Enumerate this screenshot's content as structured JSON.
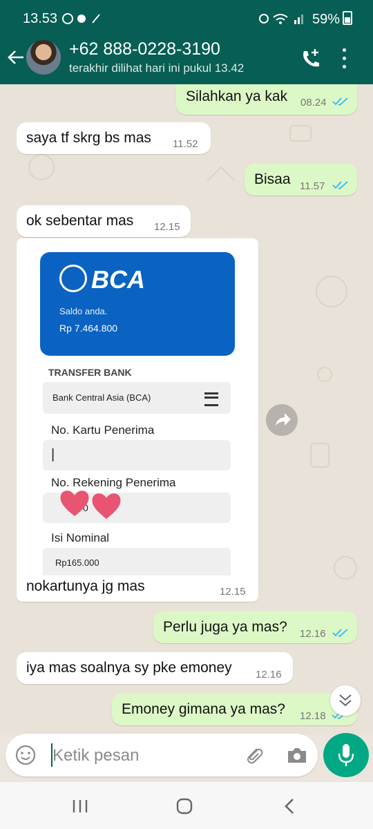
{
  "status_bar": {
    "time": "13.53",
    "battery": "59%"
  },
  "header": {
    "contact_name": "+62 888-0228-3190",
    "last_seen": "terakhir dilihat hari ini pukul 13.42"
  },
  "messages": [
    {
      "direction": "out",
      "text": "Silahkan ya kak",
      "time": "08.24",
      "read": true
    },
    {
      "direction": "in",
      "text": "saya tf skrg bs mas",
      "time": "11.52"
    },
    {
      "direction": "out",
      "text": "Bisaa",
      "time": "11.57",
      "read": true
    },
    {
      "direction": "in",
      "text": "ok sebentar mas",
      "time": "12.15"
    },
    {
      "direction": "in",
      "type": "image",
      "caption": "nokartunya jg mas",
      "time": "12.15"
    },
    {
      "direction": "out",
      "text": "Perlu juga ya mas?",
      "time": "12.16",
      "read": true
    },
    {
      "direction": "in",
      "text": "iya mas soalnya sy pke emoney",
      "time": "12.16"
    },
    {
      "direction": "out",
      "text": "Emoney gimana ya mas?",
      "time": "12.18",
      "read": true
    }
  ],
  "bca_screenshot": {
    "logo_text": "BCA",
    "saldo_label": "Saldo anda.",
    "saldo_value": "Rp 7.464.800",
    "section_title": "TRANSFER BANK",
    "bank_select": "Bank Central Asia (BCA)",
    "card_label": "No. Kartu Penerima",
    "card_value": "|",
    "account_label": "No. Rekening Penerima",
    "account_value_partial": "0",
    "amount_label": "Isi Nominal",
    "amount_value": "Rp165.000"
  },
  "composer": {
    "placeholder": "Ketik pesan"
  },
  "colors": {
    "header": "#075e54",
    "outgoing_bubble": "#dcf8c6",
    "incoming_bubble": "#ffffff",
    "accent": "#00a884",
    "read_ticks": "#34b7f1"
  },
  "icons": [
    "back-arrow-icon",
    "add-call-icon",
    "more-vert-icon",
    "forward-icon",
    "scroll-down-icon",
    "emoji-icon",
    "attach-icon",
    "camera-icon",
    "mic-icon",
    "recents-nav-icon",
    "home-nav-icon",
    "back-nav-icon"
  ]
}
